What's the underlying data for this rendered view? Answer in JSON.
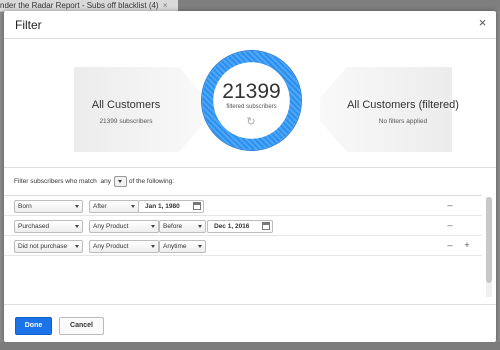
{
  "background_tab": {
    "label": "nder the Radar Report - Subs off blacklist (4)",
    "close_glyph": "×"
  },
  "dialog": {
    "title": "Filter",
    "close_glyph": "×"
  },
  "summary": {
    "left": {
      "title": "All Customers",
      "subtitle": "21399 subscribers"
    },
    "center": {
      "count": "21399",
      "label": "filtered subscribers",
      "spinner_icon": "refresh-icon"
    },
    "right": {
      "title": "All Customers (filtered)",
      "subtitle": "No filters applied"
    },
    "ring_color": "#2f8fe8"
  },
  "match_sentence": {
    "prefix": "Filter subscribers who match",
    "mode": "any",
    "suffix": "of the following:"
  },
  "filters": [
    {
      "field": "Born",
      "op": "After",
      "date": "Jan 1, 1980",
      "remove_label": "–"
    },
    {
      "field": "Purchased",
      "product": "Any Product",
      "op": "Before",
      "date": "Dec 1, 2016",
      "remove_label": "–"
    },
    {
      "field": "Did not purchase",
      "product": "Any Product",
      "op": "Anytime",
      "remove_label": "–",
      "add_label": "+"
    }
  ],
  "footer": {
    "done_label": "Done",
    "cancel_label": "Cancel"
  },
  "colors": {
    "accent": "#1a73e8"
  }
}
